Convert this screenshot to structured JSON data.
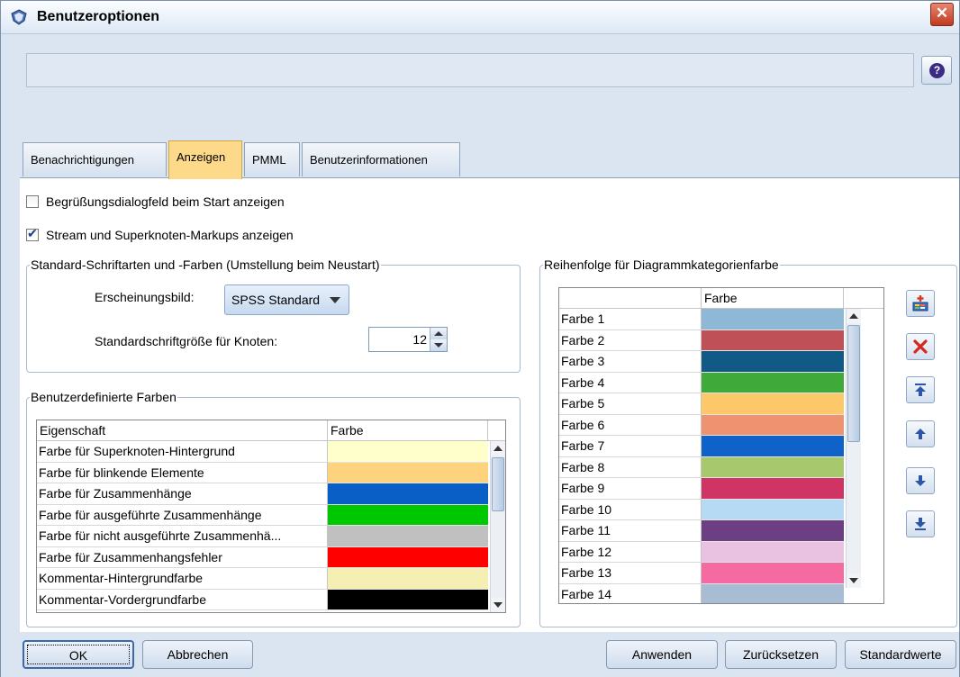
{
  "window": {
    "title": "Benutzeroptionen",
    "close_glyph": "✕"
  },
  "help": {
    "glyph": "?"
  },
  "tabs": [
    {
      "label": "Benachrichtigungen",
      "active": false
    },
    {
      "label": "Anzeigen",
      "active": true
    },
    {
      "label": "PMML",
      "active": false
    },
    {
      "label": "Benutzerinformationen",
      "active": false
    }
  ],
  "checkboxes": [
    {
      "label": "Begrüßungsdialogfeld beim Start anzeigen",
      "checked": false
    },
    {
      "label": "Stream und Superknoten-Markups anzeigen",
      "checked": true
    }
  ],
  "fonts_group": {
    "legend": "Standard-Schriftarten und -Farben (Umstellung beim Neustart)",
    "appearance_label": "Erscheinungsbild:",
    "appearance_value": "SPSS Standard",
    "font_size_label": "Standardschriftgröße für Knoten:",
    "font_size_value": "12"
  },
  "custom_colors": {
    "legend": "Benutzerdefinierte Farben",
    "col_property": "Eigenschaft",
    "col_color": "Farbe",
    "rows": [
      {
        "name": "Farbe für Superknoten-Hintergrund",
        "color": "#ffffcc"
      },
      {
        "name": "Farbe für blinkende Elemente",
        "color": "#fdd37e"
      },
      {
        "name": "Farbe für Zusammenhänge",
        "color": "#0a5fc7"
      },
      {
        "name": "Farbe für ausgeführte Zusammenhänge",
        "color": "#00c800"
      },
      {
        "name": "Farbe für nicht ausgeführte Zusammenhä...",
        "color": "#c0c0c0"
      },
      {
        "name": "Farbe für Zusammenhangsfehler",
        "color": "#ff0000"
      },
      {
        "name": "Kommentar-Hintergrundfarbe",
        "color": "#f6efb4"
      },
      {
        "name": "Kommentar-Vordergrundfarbe",
        "color": "#000000"
      }
    ]
  },
  "chart_colors": {
    "legend": "Reihenfolge für Diagrammkategorienfarbe",
    "col_name": "",
    "col_color": "Farbe",
    "rows": [
      {
        "name": "Farbe 1",
        "color": "#8fb8d6"
      },
      {
        "name": "Farbe 2",
        "color": "#c05058"
      },
      {
        "name": "Farbe 3",
        "color": "#125a86"
      },
      {
        "name": "Farbe 4",
        "color": "#3faa3a"
      },
      {
        "name": "Farbe 5",
        "color": "#fdc86a"
      },
      {
        "name": "Farbe 6",
        "color": "#ef9270"
      },
      {
        "name": "Farbe 7",
        "color": "#0f62c8"
      },
      {
        "name": "Farbe 8",
        "color": "#a7c86c"
      },
      {
        "name": "Farbe 9",
        "color": "#cf3465"
      },
      {
        "name": "Farbe 10",
        "color": "#b7daf4"
      },
      {
        "name": "Farbe 11",
        "color": "#6c3e82"
      },
      {
        "name": "Farbe 12",
        "color": "#e8c2e0"
      },
      {
        "name": "Farbe 13",
        "color": "#f56aa0"
      },
      {
        "name": "Farbe 14",
        "color": "#a8bcd4"
      }
    ]
  },
  "buttons": {
    "ok": "OK",
    "cancel": "Abbrechen",
    "apply": "Anwenden",
    "reset": "Zurücksetzen",
    "defaults": "Standardwerte"
  }
}
